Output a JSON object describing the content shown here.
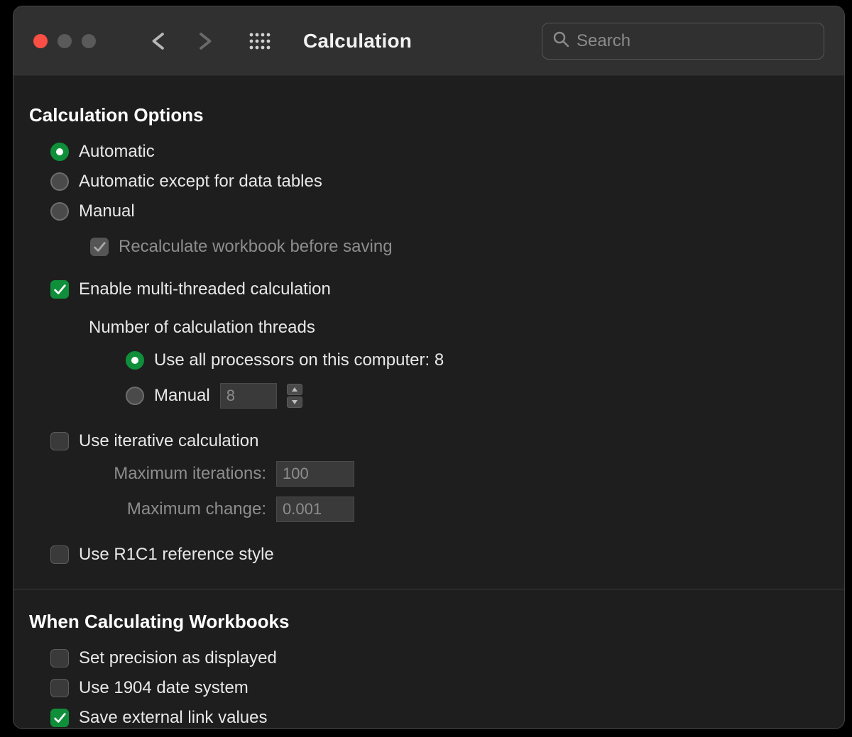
{
  "header": {
    "title": "Calculation",
    "search_placeholder": "Search"
  },
  "section1": {
    "title": "Calculation Options",
    "radios": {
      "automatic": "Automatic",
      "except_tables": "Automatic except for data tables",
      "manual": "Manual"
    },
    "recalc_on_save": "Recalculate workbook before saving",
    "enable_multithread": "Enable multi-threaded calculation",
    "threads_label": "Number of calculation threads",
    "use_all_processors_prefix": "Use all processors on this computer:",
    "processor_count": "8",
    "threads_manual": "Manual",
    "threads_manual_value": "8",
    "use_iterative": "Use iterative calculation",
    "max_iterations_label": "Maximum iterations:",
    "max_iterations_value": "100",
    "max_change_label": "Maximum change:",
    "max_change_value": "0.001",
    "use_r1c1": "Use R1C1 reference style"
  },
  "section2": {
    "title": "When Calculating Workbooks",
    "precision_as_displayed": "Set precision as displayed",
    "use_1904": "Use 1904 date system",
    "save_external_links": "Save external link values"
  }
}
